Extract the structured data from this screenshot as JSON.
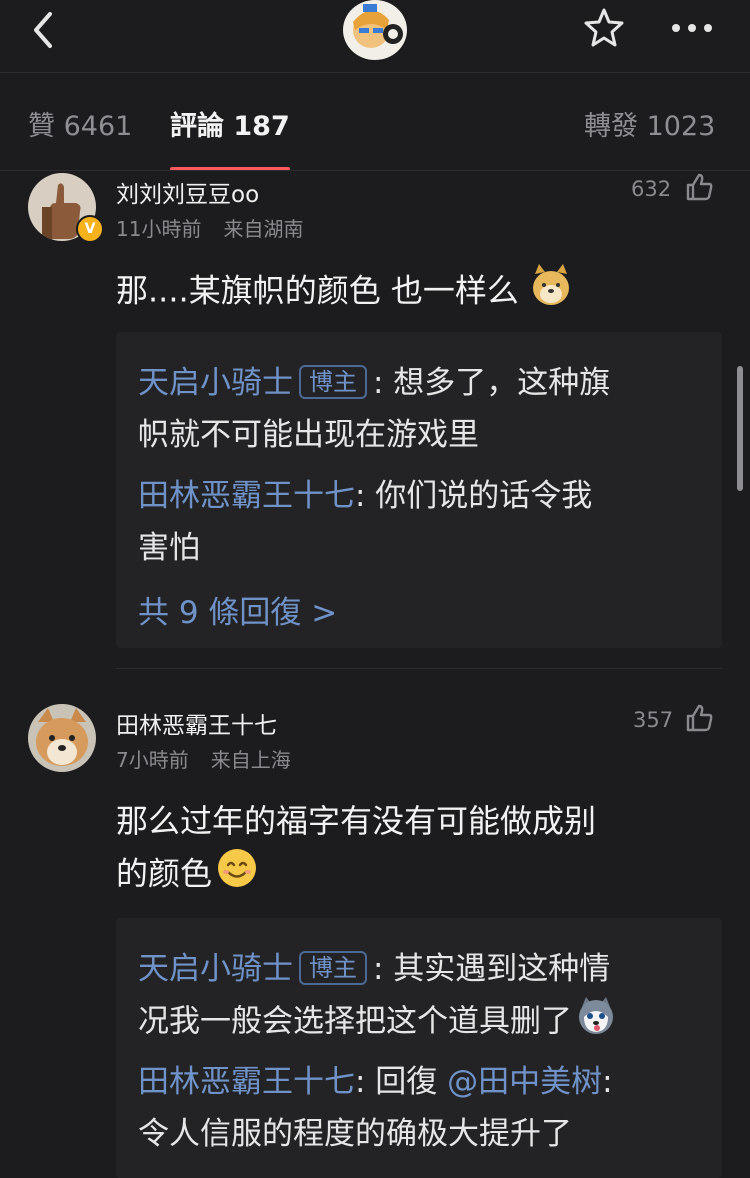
{
  "tabs": {
    "likes": "贊 6461",
    "comments": "評論 187",
    "reposts": "轉發 1023"
  },
  "icons": {
    "back": "chevron-left-icon",
    "favorite": "star-icon",
    "more": "more-horizontal-icon",
    "like": "thumbs-up-icon"
  },
  "colors": {
    "background": "#1c1c1e",
    "reply_background": "#232326",
    "link": "#6f93c8",
    "tab_indicator": "#ff5a5f",
    "verified_badge": "#f5b21b"
  },
  "comments": [
    {
      "username": "刘刘刘豆豆oo",
      "verified": true,
      "time": "11小時前",
      "location": "来自湖南",
      "likes": "632",
      "text": "那....某旗帜的颜色 也一样么",
      "emoji": "doge",
      "replies": [
        {
          "user": "天启小骑士",
          "badge": "博主",
          "lines": [
            ": 想多了，这种旗",
            "帜就不可能出现在游戏里"
          ]
        },
        {
          "user": "田林恶霸王十七",
          "lines": [
            ": 你们说的话令我",
            "害怕"
          ]
        }
      ],
      "more_replies": "共 9 條回復 >"
    },
    {
      "username": "田林恶霸王十七",
      "verified": false,
      "time": "7小時前",
      "location": "来自上海",
      "likes": "357",
      "text_lines": [
        "那么过年的福字有没有可能做成别",
        "的颜色"
      ],
      "emoji": "smile",
      "replies": [
        {
          "user": "天启小骑士",
          "badge": "博主",
          "lines": [
            ": 其实遇到这种情",
            "况我一般会选择把这个道具删了"
          ]
        },
        {
          "user": "田林恶霸王十七",
          "reply_word": ": 回復 ",
          "mention": "@田中美树",
          "lines": [
            ":",
            "令人信服的程度的确极大提升了"
          ]
        }
      ]
    }
  ]
}
